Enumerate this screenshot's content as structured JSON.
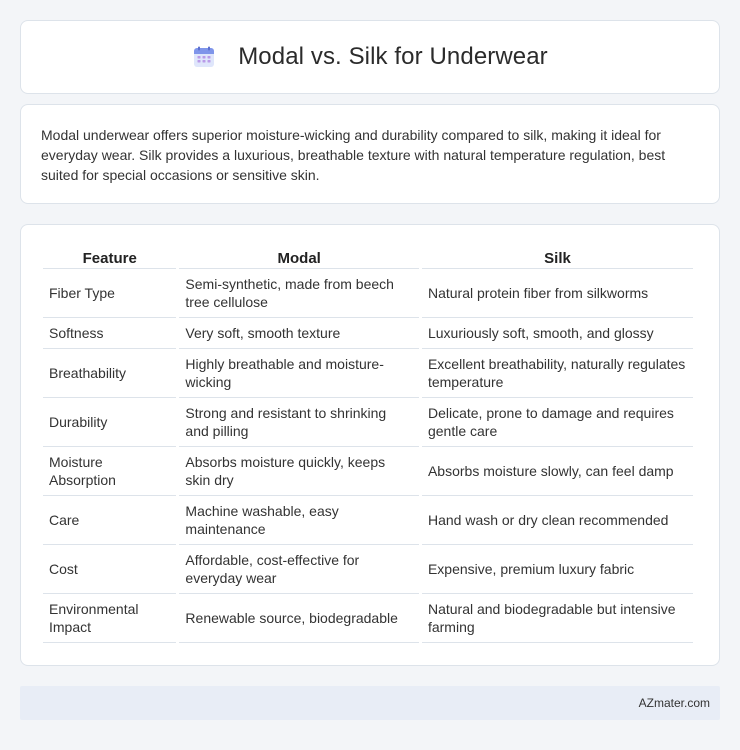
{
  "header": {
    "title": "Modal vs. Silk for Underwear",
    "icon": "calendar-icon"
  },
  "intro": {
    "text": "Modal underwear offers superior moisture-wicking and durability compared to silk, making it ideal for everyday wear. Silk provides a luxurious, breathable texture with natural temperature regulation, best suited for special occasions or sensitive skin."
  },
  "table": {
    "headers": [
      "Feature",
      "Modal",
      "Silk"
    ],
    "rows": [
      [
        "Fiber Type",
        "Semi-synthetic, made from beech tree cellulose",
        "Natural protein fiber from silkworms"
      ],
      [
        "Softness",
        "Very soft, smooth texture",
        "Luxuriously soft, smooth, and glossy"
      ],
      [
        "Breathability",
        "Highly breathable and moisture-wicking",
        "Excellent breathability, naturally regulates temperature"
      ],
      [
        "Durability",
        "Strong and resistant to shrinking and pilling",
        "Delicate, prone to damage and requires gentle care"
      ],
      [
        "Moisture Absorption",
        "Absorbs moisture quickly, keeps skin dry",
        "Absorbs moisture slowly, can feel damp"
      ],
      [
        "Care",
        "Machine washable, easy maintenance",
        "Hand wash or dry clean recommended"
      ],
      [
        "Cost",
        "Affordable, cost-effective for everyday wear",
        "Expensive, premium luxury fabric"
      ],
      [
        "Environmental Impact",
        "Renewable source, biodegradable",
        "Natural and biodegradable but intensive farming"
      ]
    ]
  },
  "footer": {
    "brand": "AZmater.com"
  }
}
